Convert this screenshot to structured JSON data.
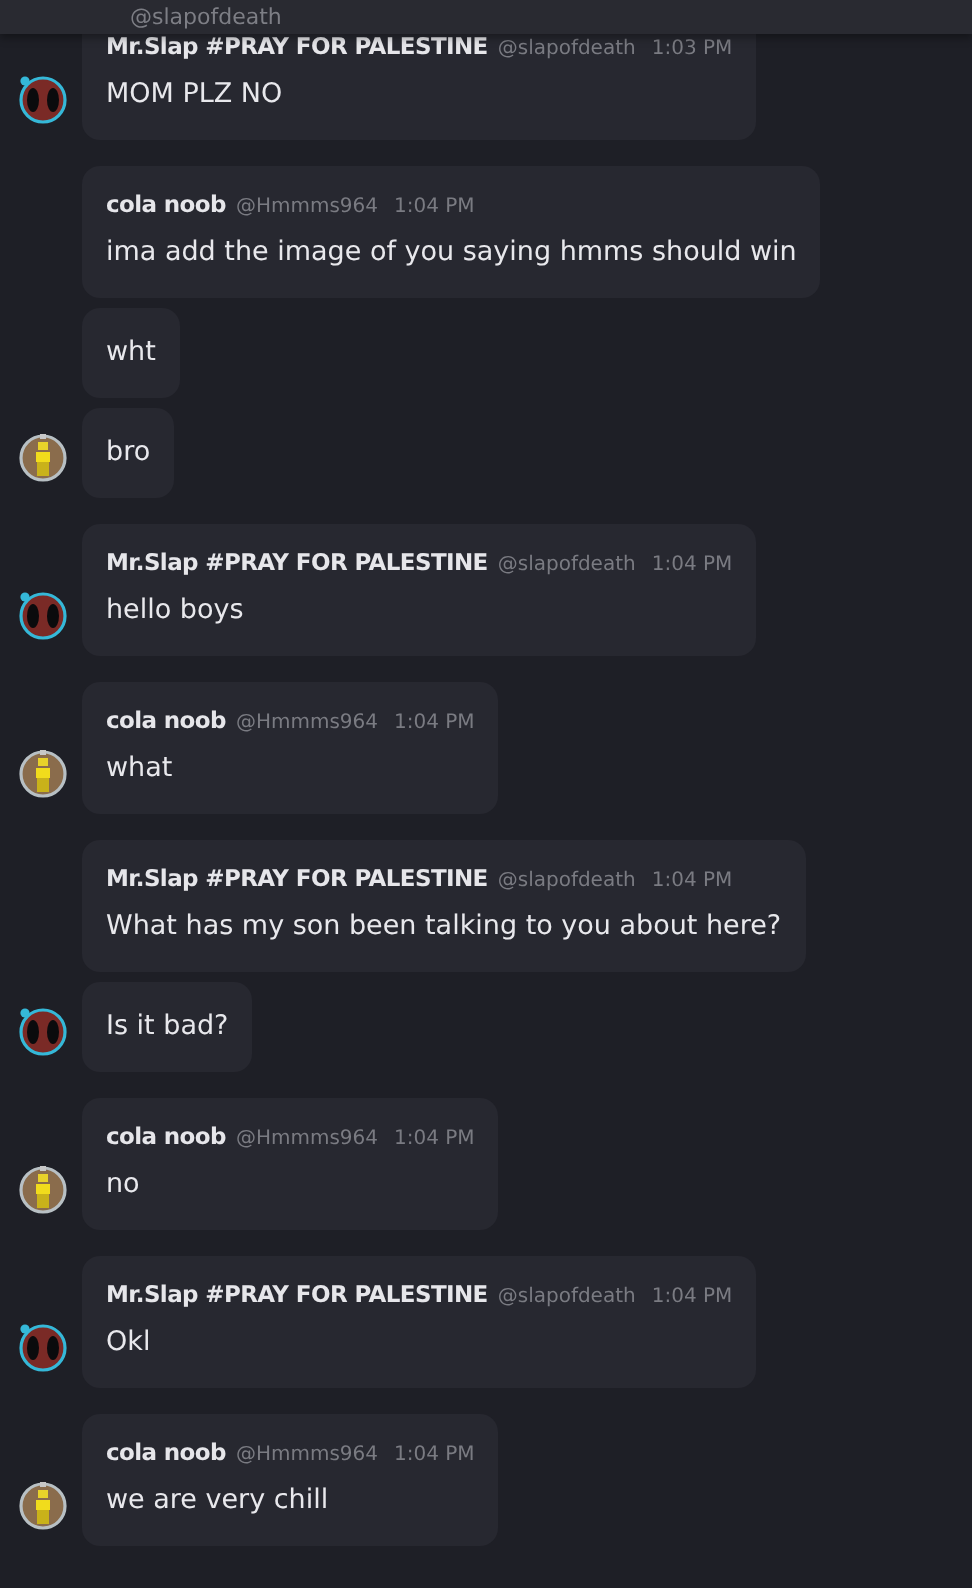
{
  "header": {
    "handle": "@slapofdeath"
  },
  "groups": [
    {
      "avatar": {
        "kind": "mask"
      },
      "author": "Mr.Slap #PRAY FOR PALESTINE",
      "handle": "@slapofdeath",
      "time": "1:03 PM",
      "messages": [
        "MOM PLZ NO"
      ]
    },
    {
      "avatar": {
        "kind": "figure"
      },
      "author": "cola noob",
      "handle": "@Hmmms964",
      "time": "1:04 PM",
      "messages": [
        "ima add the image of you saying hmms should win",
        "wht",
        "bro"
      ]
    },
    {
      "avatar": {
        "kind": "mask"
      },
      "author": "Mr.Slap #PRAY FOR PALESTINE",
      "handle": "@slapofdeath",
      "time": "1:04 PM",
      "messages": [
        "hello boys"
      ]
    },
    {
      "avatar": {
        "kind": "figure"
      },
      "author": "cola noob",
      "handle": "@Hmmms964",
      "time": "1:04 PM",
      "messages": [
        "what"
      ]
    },
    {
      "avatar": {
        "kind": "mask"
      },
      "author": "Mr.Slap #PRAY FOR PALESTINE",
      "handle": "@slapofdeath",
      "time": "1:04 PM",
      "messages": [
        "What has my son been talking to you about here?",
        "Is it bad?"
      ]
    },
    {
      "avatar": {
        "kind": "figure"
      },
      "author": "cola noob",
      "handle": "@Hmmms964",
      "time": "1:04 PM",
      "messages": [
        "no"
      ]
    },
    {
      "avatar": {
        "kind": "mask"
      },
      "author": "Mr.Slap #PRAY FOR PALESTINE",
      "handle": "@slapofdeath",
      "time": "1:04 PM",
      "messages": [
        "Okl"
      ]
    },
    {
      "avatar": {
        "kind": "figure"
      },
      "author": "cola noob",
      "handle": "@Hmmms964",
      "time": "1:04 PM",
      "messages": [
        "we are very chill"
      ]
    }
  ]
}
